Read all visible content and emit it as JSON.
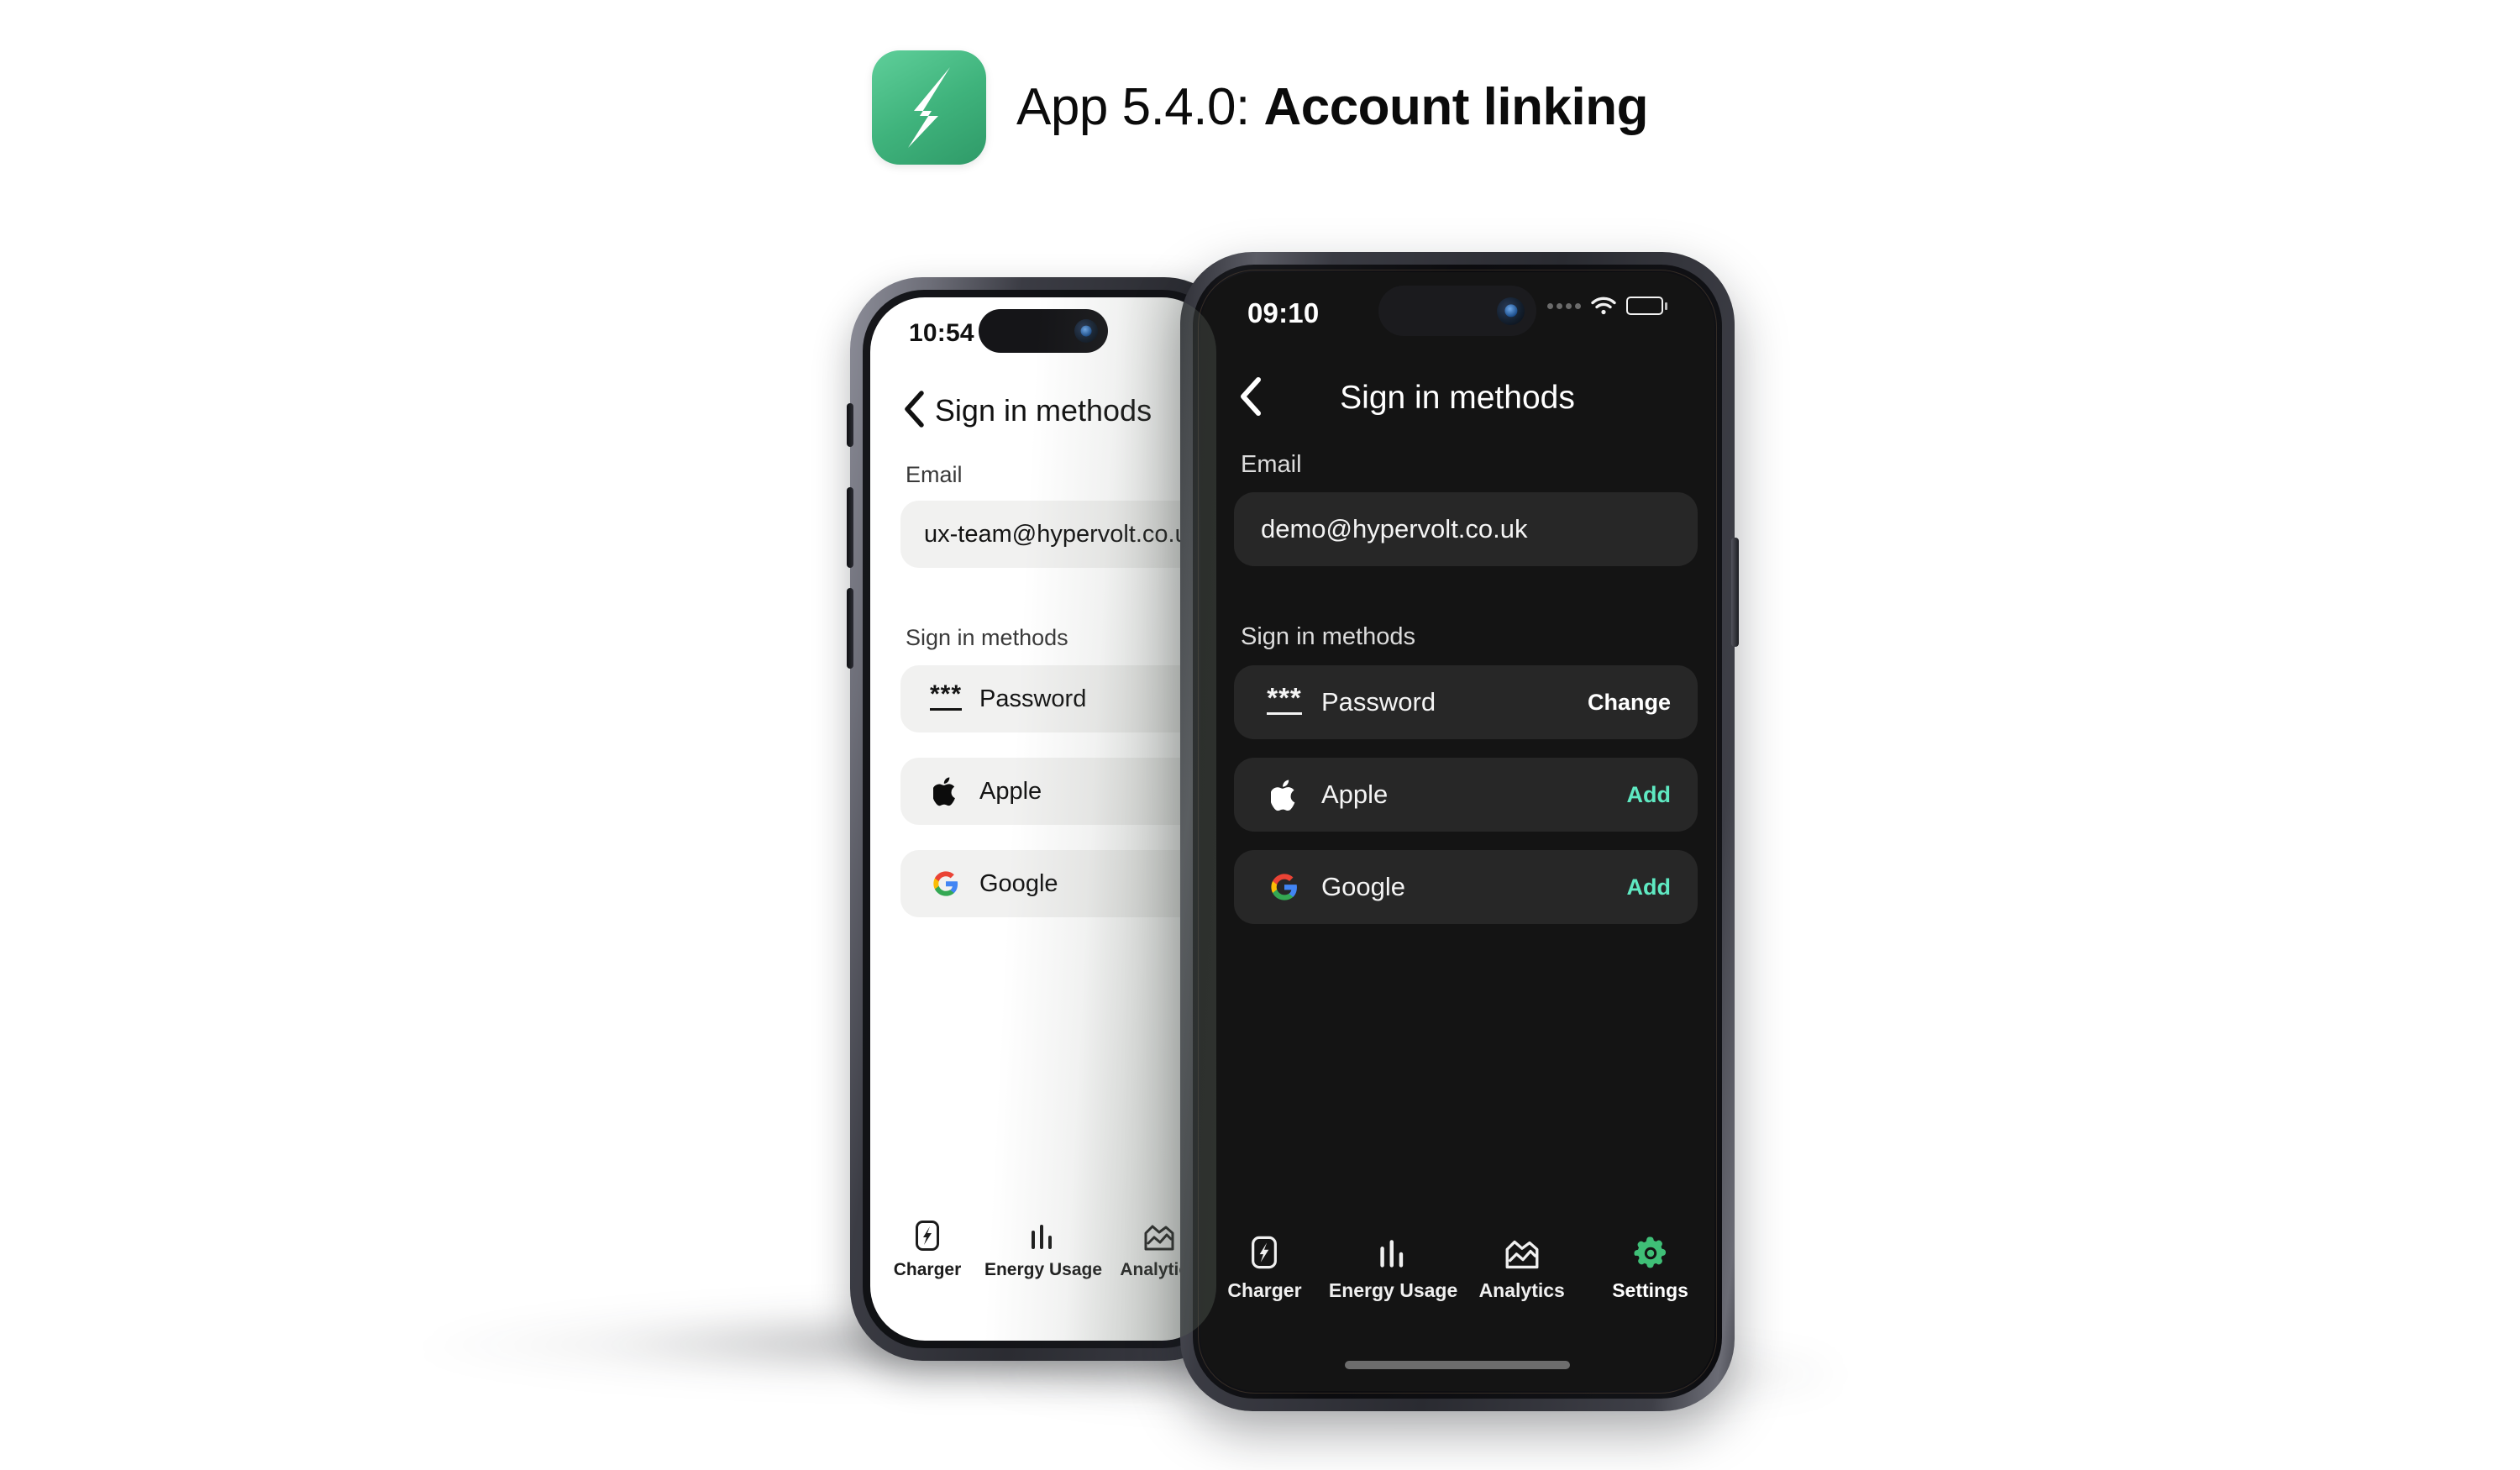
{
  "header": {
    "app_icon_name": "hypervolt-bolt-icon",
    "title_prefix": "App 5.4.0: ",
    "title_emphasis": "Account linking",
    "icon_gradient_from": "#5fcf9a",
    "icon_gradient_to": "#2f9a68"
  },
  "colors": {
    "accent_add": "#5fe9c2",
    "accent_tab_active": "#3fbf77",
    "dark_screen_bg": "#141414",
    "dark_card_bg": "#272727",
    "light_screen_bg": "#ffffff",
    "light_card_bg": "#f1f1f0"
  },
  "phone_back": {
    "theme": "light",
    "status": {
      "time": "10:54"
    },
    "nav": {
      "back_icon": "chevron-left-icon",
      "title": "Sign in methods"
    },
    "email": {
      "label": "Email",
      "value": "ux-team@hypervolt.co.uk"
    },
    "methods": {
      "label": "Sign in methods",
      "items": [
        {
          "icon": "password-dots-icon",
          "label": "Password",
          "action": ""
        },
        {
          "icon": "apple-icon",
          "label": "Apple",
          "action": ""
        },
        {
          "icon": "google-icon",
          "label": "Google",
          "action": ""
        }
      ]
    },
    "tabs": [
      {
        "icon": "charger-icon",
        "label": "Charger",
        "active": false
      },
      {
        "icon": "energy-bars-icon",
        "label": "Energy Usage",
        "active": false
      },
      {
        "icon": "analytics-icon",
        "label": "Analytics",
        "active": false
      }
    ]
  },
  "phone_front": {
    "theme": "dark",
    "status": {
      "time": "09:10",
      "signal_icon": "signal-dots-icon",
      "wifi_icon": "wifi-icon",
      "battery_icon": "battery-icon"
    },
    "nav": {
      "back_icon": "chevron-left-icon",
      "title": "Sign in methods"
    },
    "email": {
      "label": "Email",
      "value": "demo@hypervolt.co.uk"
    },
    "methods": {
      "label": "Sign in methods",
      "items": [
        {
          "icon": "password-dots-icon",
          "label": "Password",
          "action": "Change",
          "action_style": "neutral"
        },
        {
          "icon": "apple-icon",
          "label": "Apple",
          "action": "Add",
          "action_style": "accent"
        },
        {
          "icon": "google-icon",
          "label": "Google",
          "action": "Add",
          "action_style": "accent"
        }
      ]
    },
    "tabs": [
      {
        "icon": "charger-icon",
        "label": "Charger",
        "active": false
      },
      {
        "icon": "energy-bars-icon",
        "label": "Energy Usage",
        "active": false
      },
      {
        "icon": "analytics-icon",
        "label": "Analytics",
        "active": false
      },
      {
        "icon": "gear-icon",
        "label": "Settings",
        "active": true
      }
    ]
  }
}
